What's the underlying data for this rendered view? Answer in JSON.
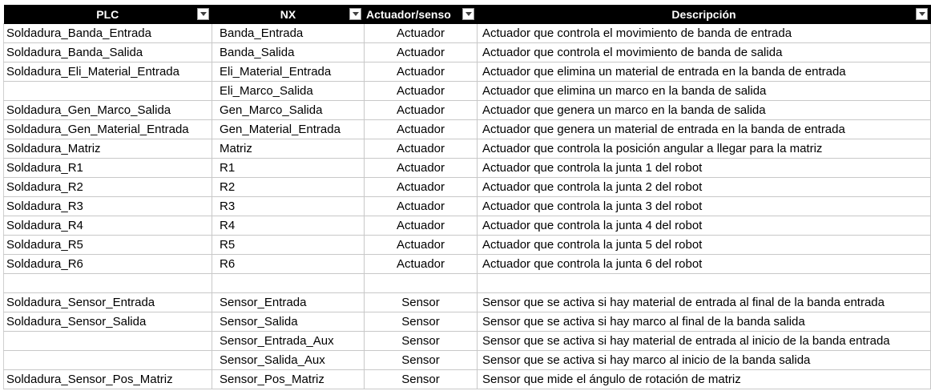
{
  "headers": {
    "plc": "PLC",
    "nx": "NX",
    "type": "Actuador/senso",
    "desc": "Descripción"
  },
  "rows": [
    {
      "plc": "Soldadura_Banda_Entrada",
      "nx": "Banda_Entrada",
      "type": "Actuador",
      "desc": "Actuador que controla el movimiento de banda de entrada"
    },
    {
      "plc": "Soldadura_Banda_Salida",
      "nx": "Banda_Salida",
      "type": "Actuador",
      "desc": "Actuador que controla el movimiento de banda de salida"
    },
    {
      "plc": "Soldadura_Eli_Material_Entrada",
      "nx": "Eli_Material_Entrada",
      "type": "Actuador",
      "desc": "Actuador que elimina un material de entrada en la banda de entrada"
    },
    {
      "plc": "",
      "nx": "Eli_Marco_Salida",
      "type": "Actuador",
      "desc": "Actuador que elimina un marco en la banda de salida"
    },
    {
      "plc": "Soldadura_Gen_Marco_Salida",
      "nx": "Gen_Marco_Salida",
      "type": "Actuador",
      "desc": "Actuador que genera un marco en la banda de salida"
    },
    {
      "plc": "Soldadura_Gen_Material_Entrada",
      "nx": "Gen_Material_Entrada",
      "type": "Actuador",
      "desc": "Actuador que genera un material de entrada en la banda de entrada"
    },
    {
      "plc": "Soldadura_Matriz",
      "nx": "Matriz",
      "type": "Actuador",
      "desc": "Actuador que controla la posición angular a llegar para la matriz"
    },
    {
      "plc": "Soldadura_R1",
      "nx": "R1",
      "type": "Actuador",
      "desc": "Actuador que controla la junta 1 del robot"
    },
    {
      "plc": "Soldadura_R2",
      "nx": "R2",
      "type": "Actuador",
      "desc": "Actuador que controla la junta 2 del robot"
    },
    {
      "plc": "Soldadura_R3",
      "nx": "R3",
      "type": "Actuador",
      "desc": "Actuador que controla la junta 3 del robot"
    },
    {
      "plc": "Soldadura_R4",
      "nx": "R4",
      "type": "Actuador",
      "desc": "Actuador que controla la junta 4 del robot"
    },
    {
      "plc": "Soldadura_R5",
      "nx": "R5",
      "type": "Actuador",
      "desc": "Actuador que controla la junta 5 del robot"
    },
    {
      "plc": "Soldadura_R6",
      "nx": "R6",
      "type": "Actuador",
      "desc": "Actuador que controla la junta 6 del robot"
    },
    {
      "plc": "",
      "nx": "",
      "type": "",
      "desc": ""
    },
    {
      "plc": "Soldadura_Sensor_Entrada",
      "nx": "Sensor_Entrada",
      "type": "Sensor",
      "desc": "Sensor que se activa si hay material de entrada al final de la banda entrada"
    },
    {
      "plc": "Soldadura_Sensor_Salida",
      "nx": "Sensor_Salida",
      "type": "Sensor",
      "desc": "Sensor que se activa si hay marco al final de la banda salida"
    },
    {
      "plc": "",
      "nx": "Sensor_Entrada_Aux",
      "type": "Sensor",
      "desc": "Sensor que se activa si hay material de entrada al inicio de la banda entrada"
    },
    {
      "plc": "",
      "nx": "Sensor_Salida_Aux",
      "type": "Sensor",
      "desc": "Sensor que se activa si hay marco al inicio de la banda salida"
    },
    {
      "plc": "Soldadura_Sensor_Pos_Matriz",
      "nx": "Sensor_Pos_Matriz",
      "type": "Sensor",
      "desc": "Sensor que mide el ángulo de rotación de matriz"
    }
  ]
}
